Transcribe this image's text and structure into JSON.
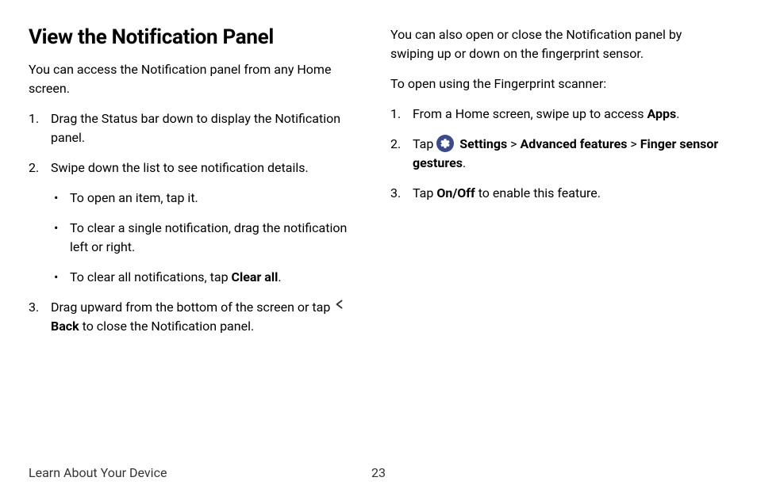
{
  "left": {
    "heading": "View the Notification Panel",
    "intro": "You can access the Notification panel from any Home screen.",
    "step1": "Drag the Status bar down to display the Notification panel.",
    "step2": "Swipe down the list to see notification details.",
    "bullet1": "To open an item, tap it.",
    "bullet2": "To clear a single notification, drag the notification left or right.",
    "bullet3_prefix": "To clear all notifications, tap ",
    "bullet3_bold": "Clear all",
    "bullet3_suffix": ".",
    "step3_prefix": "Drag upward from the bottom of the screen or tap ",
    "step3_bold": "Back",
    "step3_suffix": " to close the Notification panel."
  },
  "right": {
    "intro": "You can also open or close the Notification panel by swiping up or down on the fingerprint sensor.",
    "subintro": "To open using the Fingerprint scanner:",
    "step1_prefix": "From a Home screen, swipe up to access ",
    "step1_bold": "Apps",
    "step1_suffix": ".",
    "step2_prefix": "Tap ",
    "step2_settings": "Settings",
    "step2_sep1": " > ",
    "step2_advanced": "Advanced features",
    "step2_sep2": " > ",
    "step2_finger": "Finger sensor gestures",
    "step2_suffix": ".",
    "step3_prefix": "Tap ",
    "step3_bold": "On/Off",
    "step3_suffix": " to enable this feature."
  },
  "footer": {
    "section": "Learn About Your Device",
    "page": "23"
  }
}
